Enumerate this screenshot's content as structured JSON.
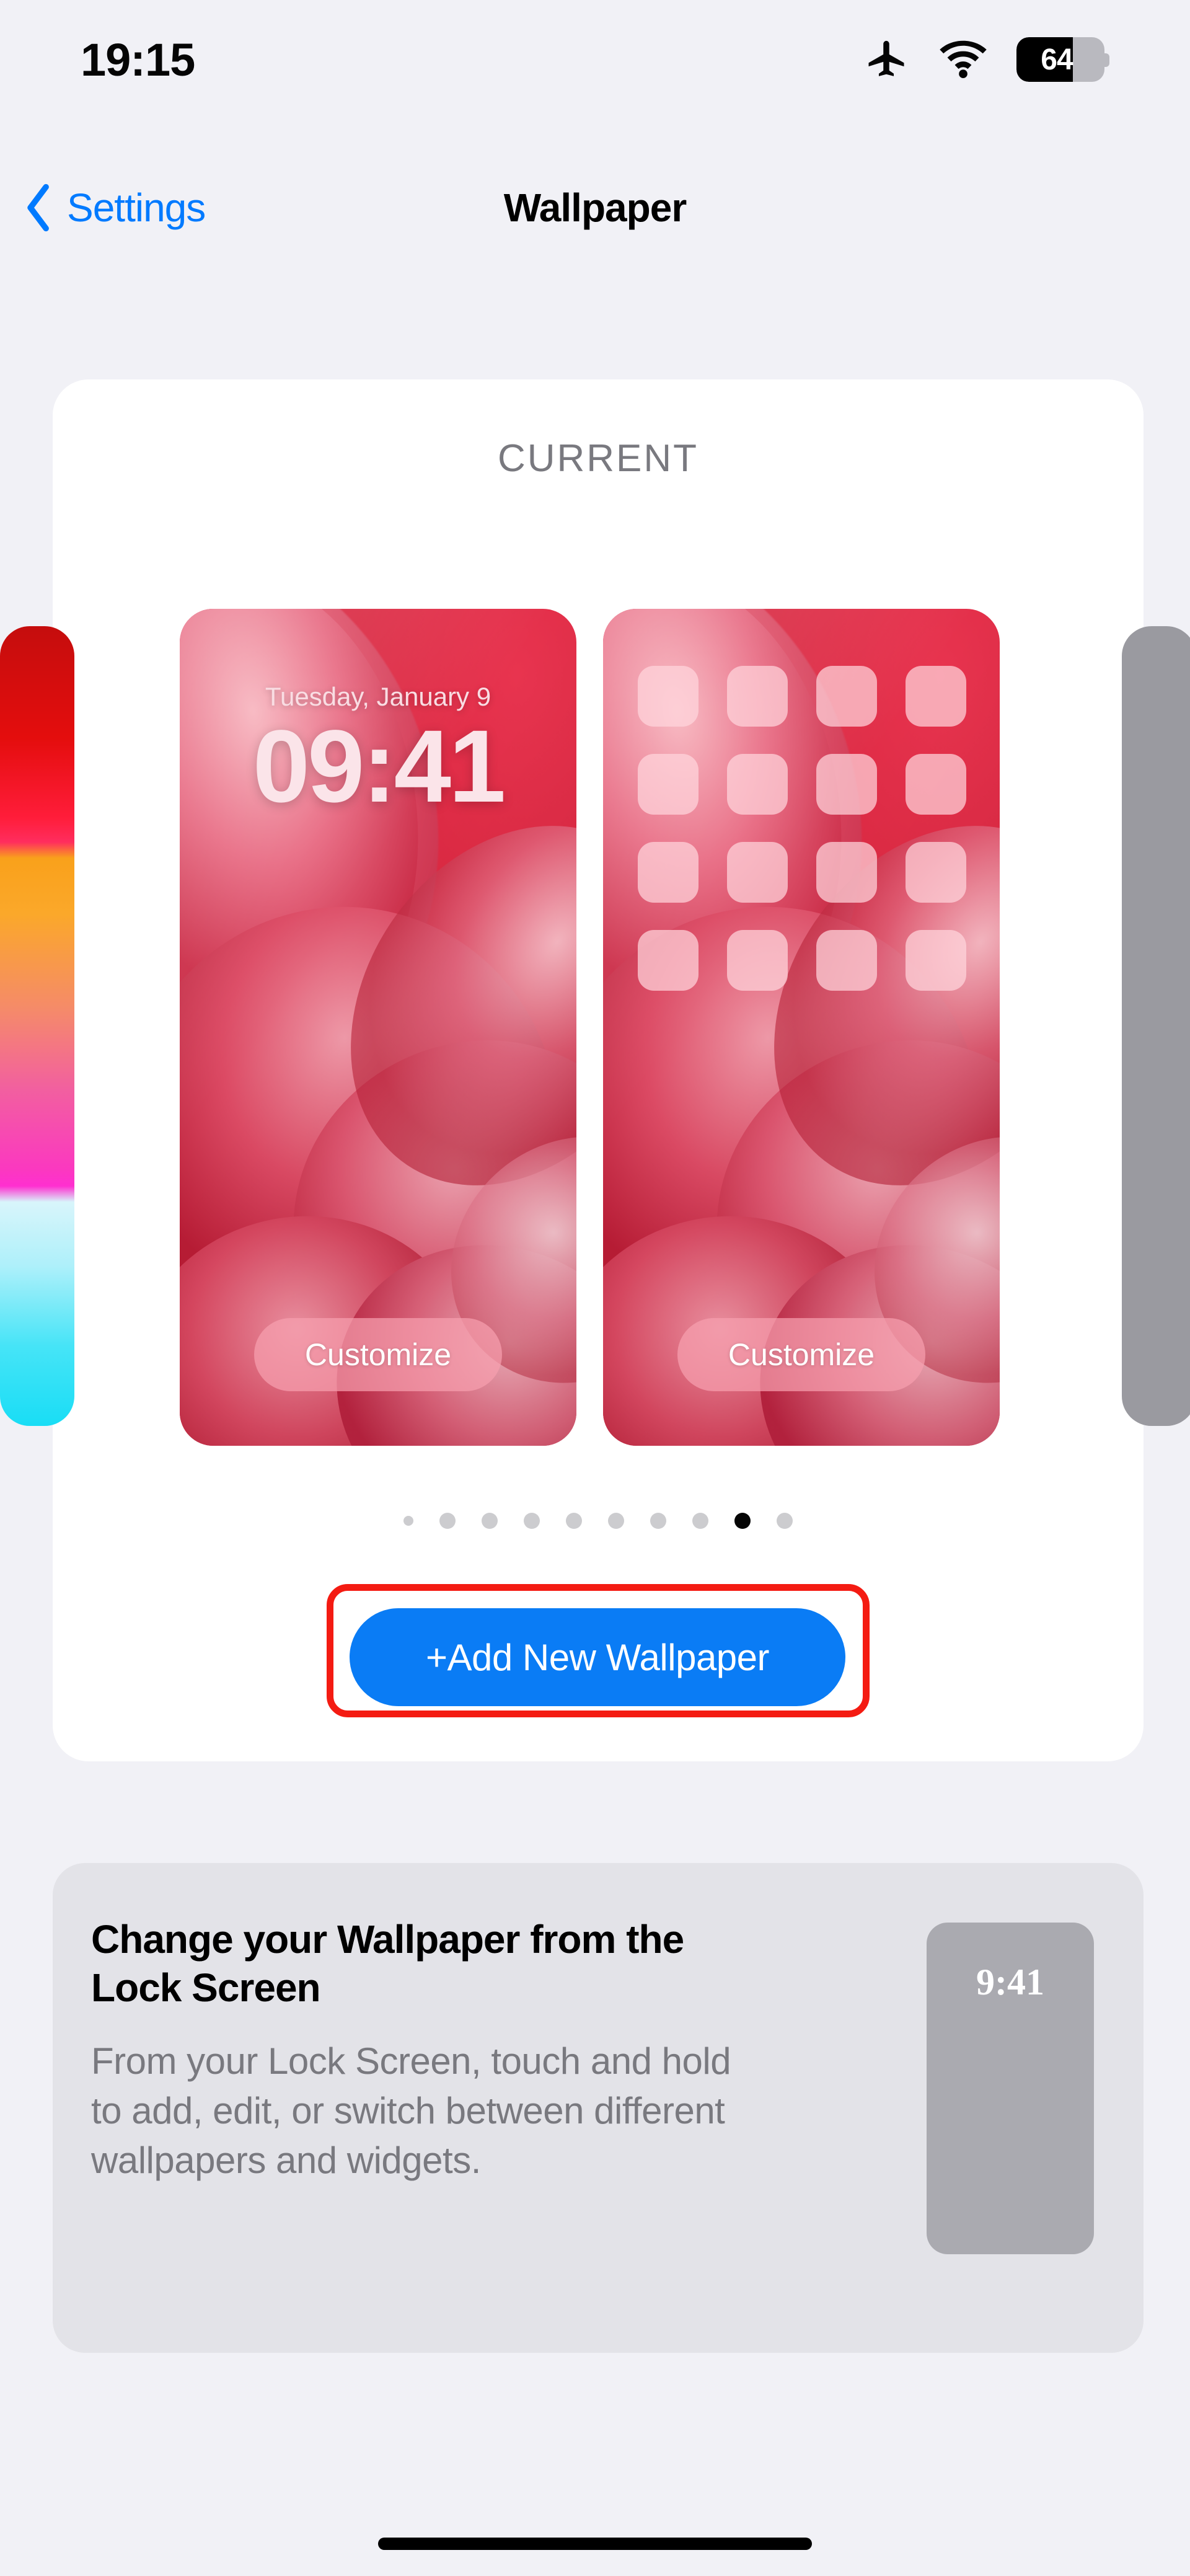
{
  "status_bar": {
    "time": "19:15",
    "battery_percent": "64",
    "battery_level": 64,
    "icons": [
      "airplane-mode-icon",
      "wifi-icon",
      "battery-icon"
    ]
  },
  "nav": {
    "back_label": "Settings",
    "back_icon": "chevron-left-icon",
    "title": "Wallpaper",
    "accent_color": "#007AFF"
  },
  "current_section": {
    "label": "CURRENT",
    "lock_preview": {
      "date": "Tuesday, January 9",
      "time": "09:41",
      "customize_label": "Customize"
    },
    "home_preview": {
      "customize_label": "Customize",
      "app_icon_count": 16
    },
    "peek_left_name": "gradient-wallpaper-peek",
    "peek_right_name": "gray-wallpaper-peek",
    "pagination": {
      "total_dots": 10,
      "active_index": 8
    },
    "add_button": {
      "label": "+Add New Wallpaper",
      "color": "#0A7CF5",
      "highlight_color": "#F41B12"
    }
  },
  "info_card": {
    "title": "Change your Wallpaper from the Lock Screen",
    "body": "From your Lock Screen, touch and hold to add, edit, or switch between different wallpapers and widgets.",
    "thumb_time": "9:41"
  }
}
